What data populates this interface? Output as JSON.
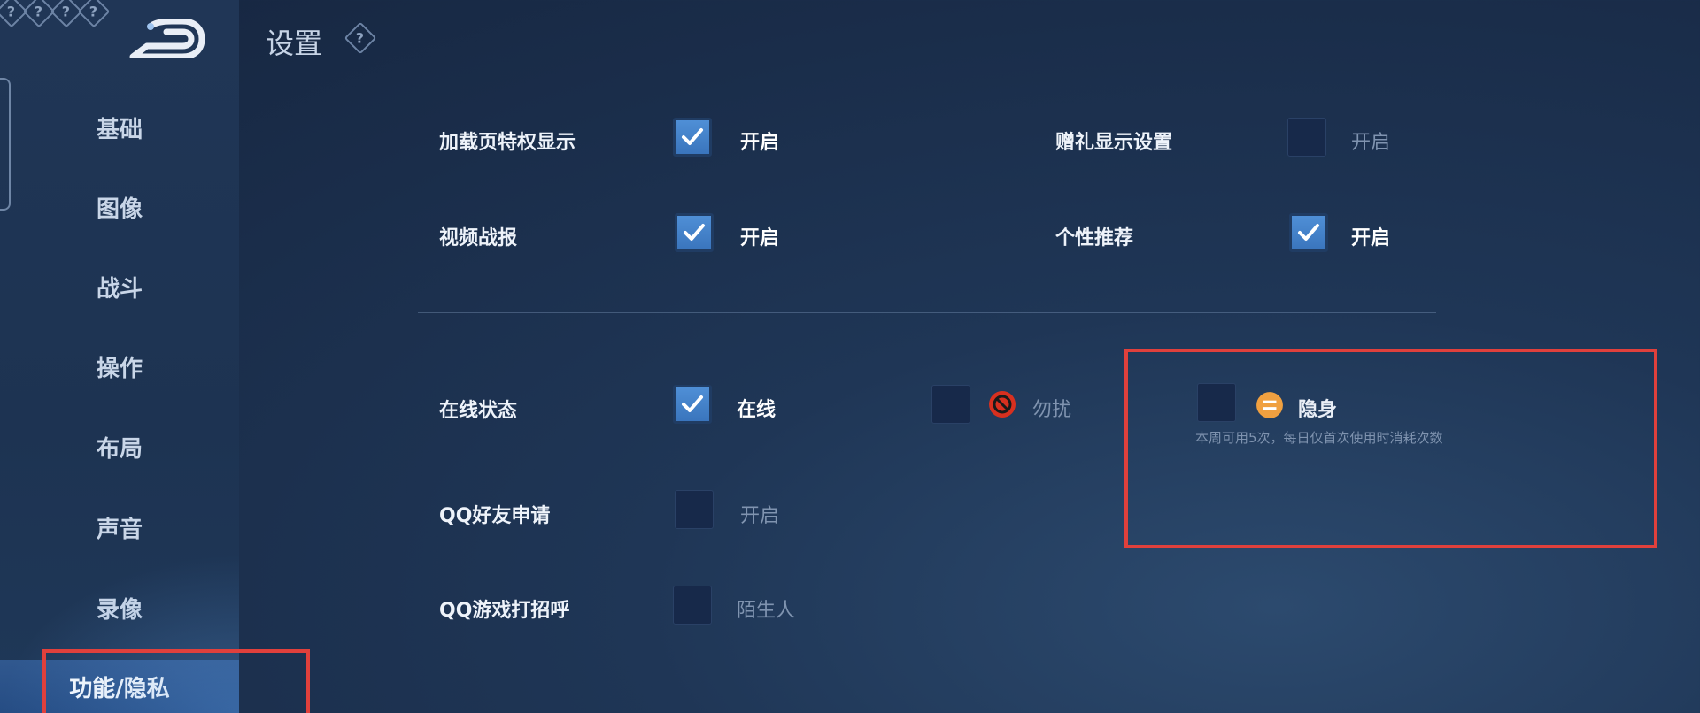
{
  "header": {
    "title": "设置",
    "help_glyph": "?"
  },
  "sidebar": {
    "items": [
      {
        "label": "基础",
        "active": false
      },
      {
        "label": "图像",
        "active": false
      },
      {
        "label": "战斗",
        "active": false
      },
      {
        "label": "操作",
        "active": false
      },
      {
        "label": "布局",
        "active": false
      },
      {
        "label": "声音",
        "active": false
      },
      {
        "label": "录像",
        "active": false
      },
      {
        "label": "功能/隐私",
        "active": true
      }
    ]
  },
  "settings": {
    "loading_privilege": {
      "label": "加载页特权显示",
      "option": "开启",
      "checked": true
    },
    "gift_display": {
      "label": "赠礼显示设置",
      "option": "开启",
      "checked": false
    },
    "video_report": {
      "label": "视频战报",
      "option": "开启",
      "checked": true
    },
    "personal_recommend": {
      "label": "个性推荐",
      "option": "开启",
      "checked": true
    },
    "online_status": {
      "label": "在线状态",
      "options": {
        "online": {
          "label": "在线",
          "checked": true
        },
        "dnd": {
          "label": "勿扰",
          "checked": false
        },
        "invisible": {
          "label": "隐身",
          "checked": false
        }
      },
      "invisible_note": "本周可用5次，每日仅首次使用时消耗次数"
    },
    "qq_friend_request": {
      "label": "QQ好友申请",
      "option": "开启",
      "checked": false
    },
    "qq_game_greeting": {
      "label": "QQ游戏打招呼",
      "option": "陌生人",
      "checked": false
    }
  },
  "colors": {
    "accent": "#4f8fd6",
    "highlight_box": "#e0403c",
    "dnd_icon": "#d8301f",
    "invisible_icon": "#f0a040"
  }
}
